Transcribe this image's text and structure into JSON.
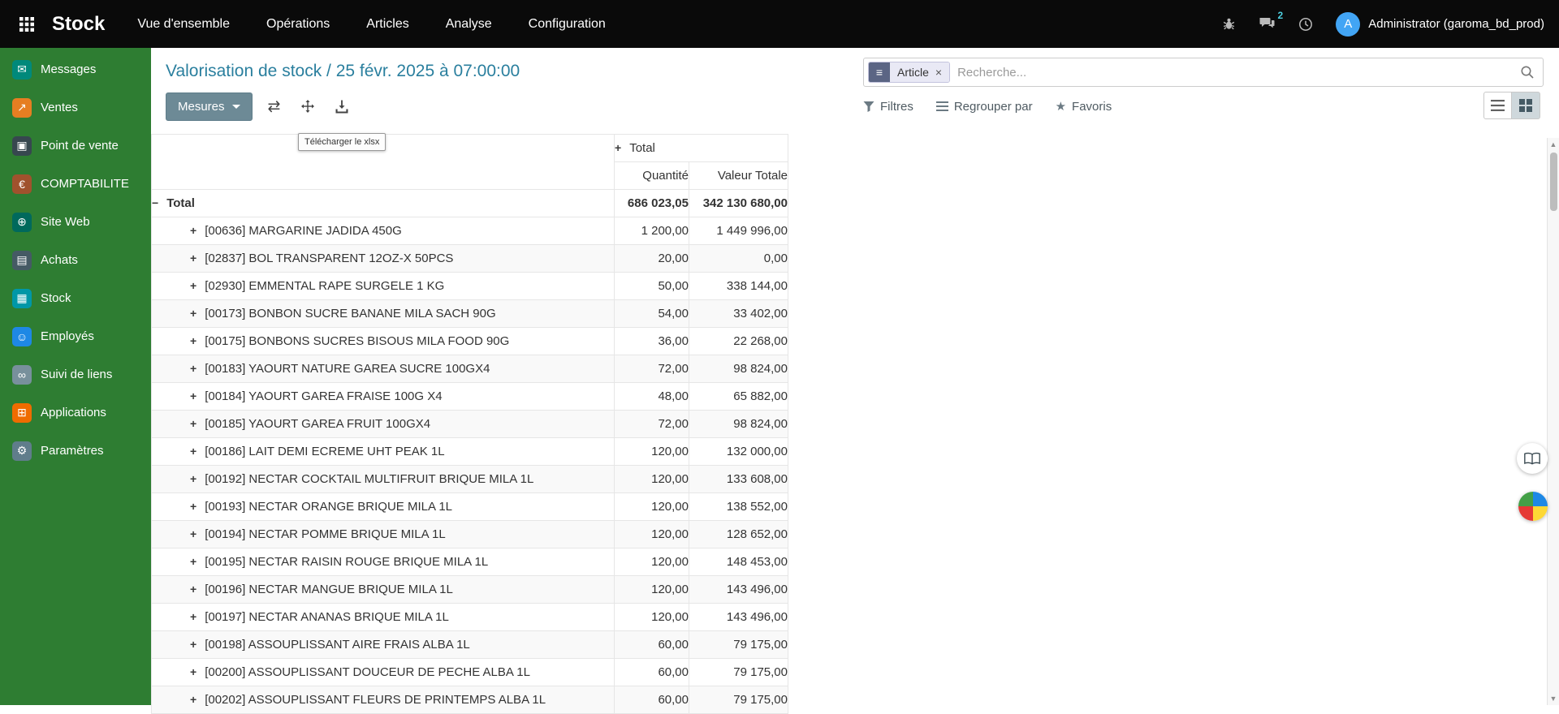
{
  "navbar": {
    "app_name": "Stock",
    "menus": [
      "Vue d'ensemble",
      "Opérations",
      "Articles",
      "Analyse",
      "Configuration"
    ],
    "message_badge": "2",
    "avatar_letter": "A",
    "user": "Administrator (garoma_bd_prod)"
  },
  "sidebar": {
    "items": [
      {
        "label": "Messages",
        "icon": "chat-icon",
        "color": "#00897b"
      },
      {
        "label": "Ventes",
        "icon": "sales-icon",
        "color": "#e67e22"
      },
      {
        "label": "Point de vente",
        "icon": "pos-icon",
        "color": "#37474f"
      },
      {
        "label": "COMPTABILITE",
        "icon": "accounting-icon",
        "color": "#a0522d"
      },
      {
        "label": "Site Web",
        "icon": "website-icon",
        "color": "#00695c"
      },
      {
        "label": "Achats",
        "icon": "purchases-icon",
        "color": "#455a64"
      },
      {
        "label": "Stock",
        "icon": "stock-icon",
        "color": "#0097a7"
      },
      {
        "label": "Employés",
        "icon": "employees-icon",
        "color": "#1e88e5"
      },
      {
        "label": "Suivi de liens",
        "icon": "link-icon",
        "color": "#78909c"
      },
      {
        "label": "Applications",
        "icon": "apps-icon",
        "color": "#ef6c00"
      },
      {
        "label": "Paramètres",
        "icon": "settings-icon",
        "color": "#607d8b"
      }
    ]
  },
  "header": {
    "title": "Valorisation de stock / 25 févr. 2025 à 07:00:00"
  },
  "toolbar": {
    "measures_label": "Mesures",
    "download_tooltip": "Télécharger le xlsx"
  },
  "search": {
    "facet_label": "Article",
    "placeholder": "Recherche...",
    "filters_label": "Filtres",
    "group_by_label": "Regrouper par",
    "favorites_label": "Favoris"
  },
  "colors": {
    "sidebar_green": "#2e7d32",
    "navbar_black": "#0a0a0a",
    "title_accent": "#2a7f9e",
    "avatar_blue": "#42a5f5",
    "badge_teal": "#4dd0e1"
  },
  "pivot": {
    "col_group_label": "Total",
    "col_headers": [
      "Quantité",
      "Valeur Totale"
    ],
    "total_row": {
      "label": "Total",
      "qty": "686 023,05",
      "value": "342 130 680,00"
    },
    "rows": [
      {
        "label": "[00636] MARGARINE JADIDA 450G",
        "qty": "1 200,00",
        "value": "1 449 996,00"
      },
      {
        "label": "[02837] BOL TRANSPARENT 12OZ-X 50PCS",
        "qty": "20,00",
        "value": "0,00"
      },
      {
        "label": "[02930] EMMENTAL RAPE SURGELE 1 KG",
        "qty": "50,00",
        "value": "338 144,00"
      },
      {
        "label": "[00173] BONBON SUCRE BANANE MILA SACH 90G",
        "qty": "54,00",
        "value": "33 402,00"
      },
      {
        "label": "[00175] BONBONS SUCRES BISOUS MILA FOOD 90G",
        "qty": "36,00",
        "value": "22 268,00"
      },
      {
        "label": "[00183] YAOURT NATURE GAREA SUCRE 100GX4",
        "qty": "72,00",
        "value": "98 824,00"
      },
      {
        "label": "[00184] YAOURT GAREA FRAISE 100G X4",
        "qty": "48,00",
        "value": "65 882,00"
      },
      {
        "label": "[00185] YAOURT GAREA FRUIT 100GX4",
        "qty": "72,00",
        "value": "98 824,00"
      },
      {
        "label": "[00186] LAIT DEMI ECREME UHT PEAK 1L",
        "qty": "120,00",
        "value": "132 000,00"
      },
      {
        "label": "[00192] NECTAR COCKTAIL MULTIFRUIT BRIQUE MILA 1L",
        "qty": "120,00",
        "value": "133 608,00"
      },
      {
        "label": "[00193] NECTAR ORANGE BRIQUE MILA 1L",
        "qty": "120,00",
        "value": "138 552,00"
      },
      {
        "label": "[00194] NECTAR POMME BRIQUE MILA 1L",
        "qty": "120,00",
        "value": "128 652,00"
      },
      {
        "label": "[00195] NECTAR RAISIN ROUGE BRIQUE MILA 1L",
        "qty": "120,00",
        "value": "148 453,00"
      },
      {
        "label": "[00196] NECTAR MANGUE BRIQUE MILA 1L",
        "qty": "120,00",
        "value": "143 496,00"
      },
      {
        "label": "[00197] NECTAR ANANAS BRIQUE MILA 1L",
        "qty": "120,00",
        "value": "143 496,00"
      },
      {
        "label": "[00198] ASSOUPLISSANT AIRE FRAIS ALBA 1L",
        "qty": "60,00",
        "value": "79 175,00"
      },
      {
        "label": "[00200] ASSOUPLISSANT DOUCEUR DE PECHE ALBA 1L",
        "qty": "60,00",
        "value": "79 175,00"
      },
      {
        "label": "[00202] ASSOUPLISSANT FLEURS DE PRINTEMPS ALBA 1L",
        "qty": "60,00",
        "value": "79 175,00"
      }
    ]
  }
}
